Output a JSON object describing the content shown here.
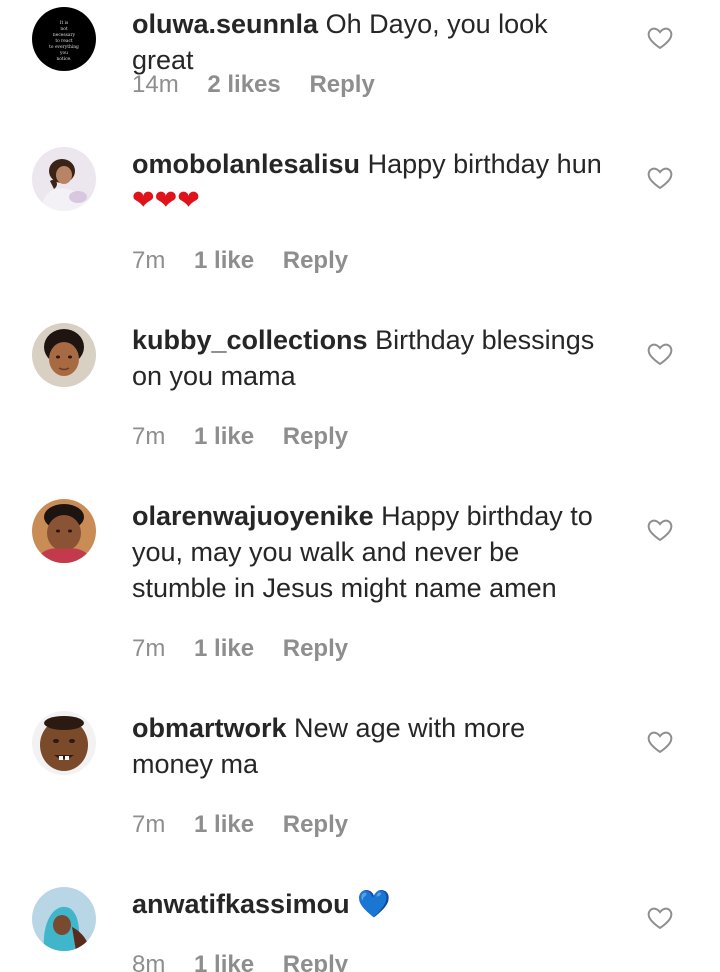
{
  "comments": [
    {
      "username": "oluwa.seunnla",
      "text": "Oh Dayo, you look great",
      "time": "14m",
      "likes": "2 likes",
      "reply": "Reply",
      "avatar_text": "It is not necessary to react to everything you notice.",
      "like_icon": "heart-outline-icon"
    },
    {
      "username": "omobolanlesalisu",
      "text": "Happy birthday hun",
      "emoji": "❤❤❤",
      "time": "7m",
      "likes": "1 like",
      "reply": "Reply",
      "like_icon": "heart-outline-icon"
    },
    {
      "username": "kubby_collections",
      "text": "Birthday blessings on you mama",
      "time": "7m",
      "likes": "1 like",
      "reply": "Reply",
      "like_icon": "heart-outline-icon"
    },
    {
      "username": "olarenwajuoyenike",
      "text": "Happy birthday to you, may you walk and never be stumble in Jesus might name amen",
      "time": "7m",
      "likes": "1 like",
      "reply": "Reply",
      "like_icon": "heart-outline-icon"
    },
    {
      "username": "obmartwork",
      "text": "New age with more money ma",
      "time": "7m",
      "likes": "1 like",
      "reply": "Reply",
      "like_icon": "heart-outline-icon"
    },
    {
      "username": "anwatifkassimou",
      "text": "",
      "emoji": "💙",
      "time": "8m",
      "likes": "1 like",
      "reply": "Reply",
      "like_icon": "heart-outline-icon"
    }
  ],
  "colors": {
    "text": "#262626",
    "meta": "#8e8e8e",
    "red_heart": "#e0121a",
    "blue_heart": "#1f7ae0"
  }
}
